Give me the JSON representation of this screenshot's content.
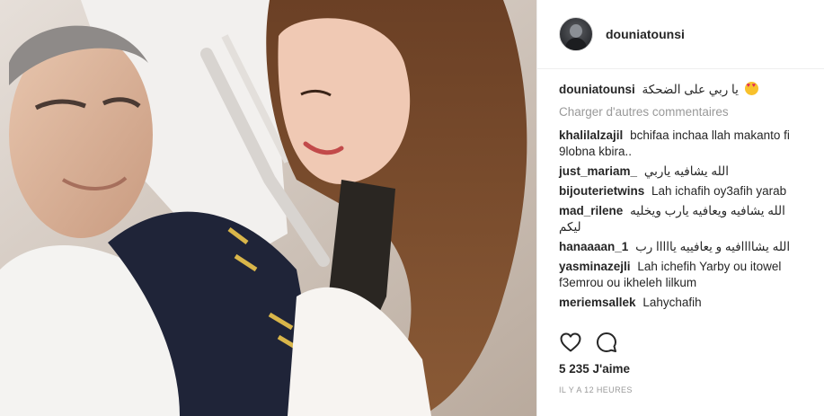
{
  "post": {
    "photo_alt": "",
    "author": "douniatounsi",
    "caption": {
      "author": "douniatounsi",
      "text": "يا ربي على الضحكة",
      "emoji": "heart-eyes-emoji"
    },
    "load_more_label": "Charger d'autres commentaires",
    "comments": [
      {
        "author": "khalilalzajil",
        "text": "bchifaa inchaa llah makanto fi 9lobna kbira.."
      },
      {
        "author": "just_mariam_",
        "text": "الله يشافيه ياربي"
      },
      {
        "author": "bijouterietwins",
        "text": "Lah ichafih oy3afih yarab"
      },
      {
        "author": "mad_rilene",
        "text": "الله يشافيه ويعافيه يارب ويخليه ليكم"
      },
      {
        "author": "hanaaaan_1",
        "text": "الله يشاااافيه و يعافييه يااااا رب"
      },
      {
        "author": "yasminazejli",
        "text": "Lah ichefih Yarby ou itowel f3emrou ou ikheleh lilkum"
      },
      {
        "author": "meriemsallek",
        "text": "Lahychafih"
      }
    ],
    "likes": "5 235 J'aime",
    "time": "IL Y A 12 HEURES"
  },
  "icons": {
    "like": "heart-outline-icon",
    "comment": "comment-bubble-icon"
  },
  "colors": {
    "text": "#262626",
    "muted": "#999999",
    "border": "#efefef"
  }
}
